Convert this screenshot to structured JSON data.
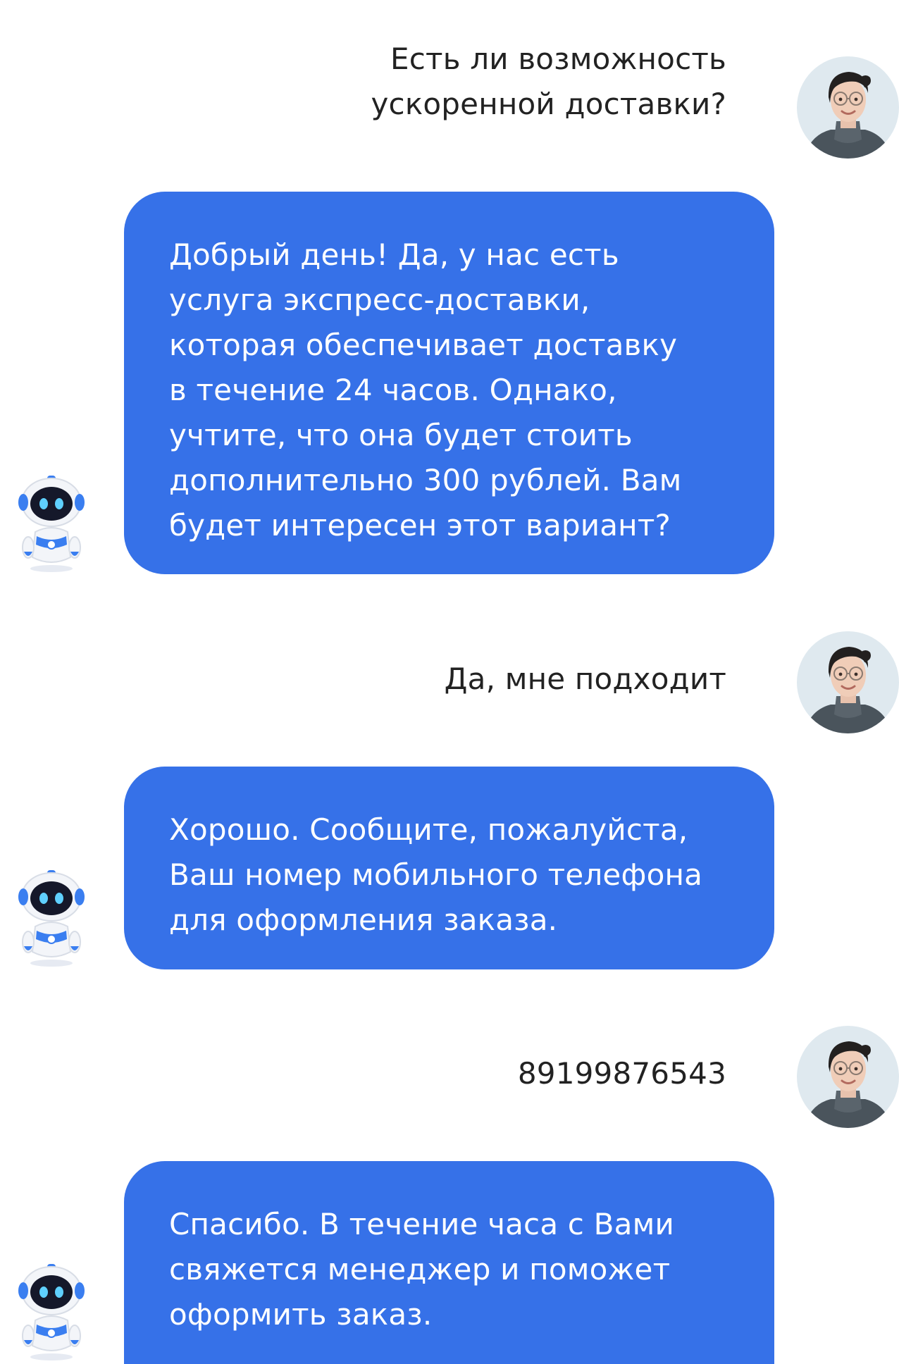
{
  "colors": {
    "bubble": "#3671e8",
    "user_text": "#222222",
    "background": "#ffffff"
  },
  "icons": {
    "user_avatar": "woman-avatar-photo",
    "bot_avatar": "robot-mascot-icon"
  },
  "messages": [
    {
      "sender": "user",
      "text": "Есть ли возможность\nускоренной доставки?"
    },
    {
      "sender": "bot",
      "text": "Добрый день! Да, у нас есть\nуслуга экспресс-доставки,\nкоторая обеспечивает доставку\nв течение 24 часов. Однако,\nучтите, что она будет стоить\nдополнительно 300 рублей. Вам\nбудет интересен этот вариант?"
    },
    {
      "sender": "user",
      "text": "Да, мне подходит"
    },
    {
      "sender": "bot",
      "text": "Хорошо. Сообщите, пожалуйста,\nВаш номер мобильного телефона\nдля оформления заказа."
    },
    {
      "sender": "user",
      "text": "89199876543"
    },
    {
      "sender": "bot",
      "text": "Спасибо. В течение часа с Вами\nсвяжется менеджер и поможет\nоформить заказ."
    }
  ]
}
